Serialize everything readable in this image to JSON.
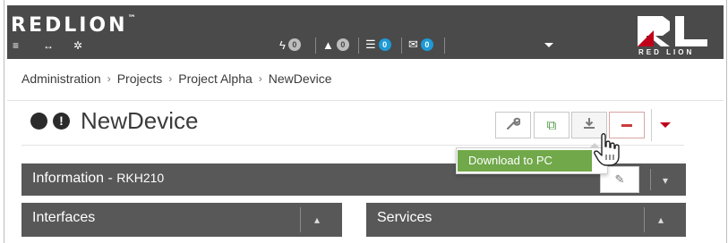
{
  "header": {
    "logo_text": "REDLION",
    "logo_tm": "™",
    "rl_text": "RED LION",
    "menu_icon": "hamburger-icon",
    "expand_icon": "arrows-icon",
    "spinner_icon": "spinner-icon",
    "status": {
      "power_count": "0",
      "warning_count": "0",
      "device_count": "0",
      "mail_count": "0"
    }
  },
  "breadcrumb": {
    "items": [
      "Administration",
      "Projects",
      "Project Alpha",
      "NewDevice"
    ],
    "separator": "›"
  },
  "device": {
    "title": "NewDevice",
    "warning_glyph": "!"
  },
  "toolbar": {
    "wrench_glyph": "🔧",
    "copy_glyph": "⧉",
    "download_glyph": "⤓",
    "tooltip": "Download to PC"
  },
  "panels": {
    "information": {
      "label": "Information - ",
      "model": "RKH210"
    },
    "interfaces": {
      "label": "Interfaces"
    },
    "services": {
      "label": "Services"
    },
    "chevron_down": "⌄",
    "chevron_up": "⌃"
  },
  "colors": {
    "topbar": "#4a4a4a",
    "panel": "#585858",
    "accent_red": "#c0001a",
    "badge_blue": "#1e9ad6",
    "tooltip_green": "#70a84a"
  }
}
